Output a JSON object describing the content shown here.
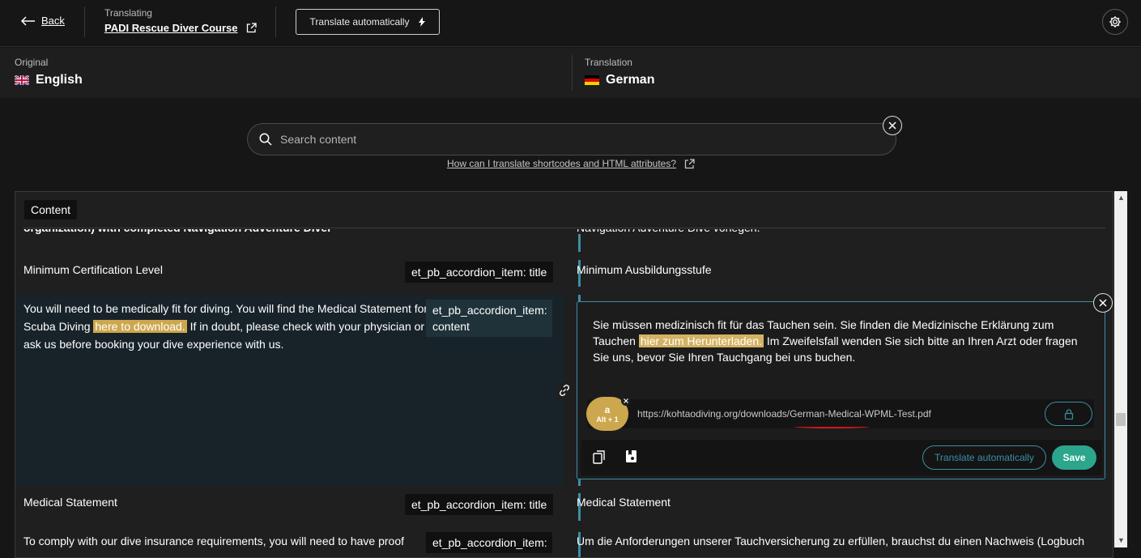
{
  "header": {
    "back_label": "Back",
    "translating_label": "Translating",
    "course_title": "PADI Rescue Diver Course",
    "translate_auto_label": "Translate automatically"
  },
  "languages": {
    "original_label": "Original",
    "original_name": "English",
    "translation_label": "Translation",
    "translation_name": "German"
  },
  "search": {
    "placeholder": "Search content",
    "help_link": "How can I translate shortcodes and HTML attributes?"
  },
  "panel": {
    "tab_label": "Content",
    "rows": [
      {
        "original_cut": "organization) with completed Navigation Adventure Diver",
        "translation_cut": "Navigation Adventure Dive vorlegen."
      },
      {
        "original": "Minimum Certification Level",
        "tag": "et_pb_accordion_item: title",
        "translation": "Minimum Ausbildungsstufe"
      },
      {
        "original_pre": "You will need to be medically fit for diving. You will find the Medical Statement for Scuba Diving ",
        "original_hl": "here to download.",
        "original_post": " If in doubt, please check with your physician or ask us before booking your dive experience with us.",
        "tag": "et_pb_accordion_item: content",
        "translation_pre": "Sie müssen medizinisch fit für das Tauchen sein. Sie finden die Medizinische Erklärung zum Tauchen ",
        "translation_hl": "hier zum Herunterladen.",
        "translation_post": " Im Zweifelsfall wenden Sie sich bitte an Ihren Arzt oder fragen Sie uns, bevor Sie Ihren Tauchgang bei uns buchen."
      },
      {
        "original": "Medical Statement",
        "tag": "et_pb_accordion_item: title",
        "translation": "Medical Statement"
      },
      {
        "original": "To comply with our dive insurance requirements, you will need to have proof",
        "tag": "et_pb_accordion_item:",
        "translation": "Um die Anforderungen unserer Tauchversicherung zu erfüllen, brauchst du einen Nachweis (Logbuch"
      }
    ]
  },
  "editor": {
    "link_badge": "a",
    "link_shortcut": "Alt + 1",
    "link_url": "https://kohtaodiving.org/downloads/German-Medical-WPML-Test.pdf",
    "translate_auto_label": "Translate automatically",
    "save_label": "Save"
  },
  "colors": {
    "accent": "#3c8fa5",
    "highlight": "#cda74e",
    "save": "#2ca58d"
  }
}
